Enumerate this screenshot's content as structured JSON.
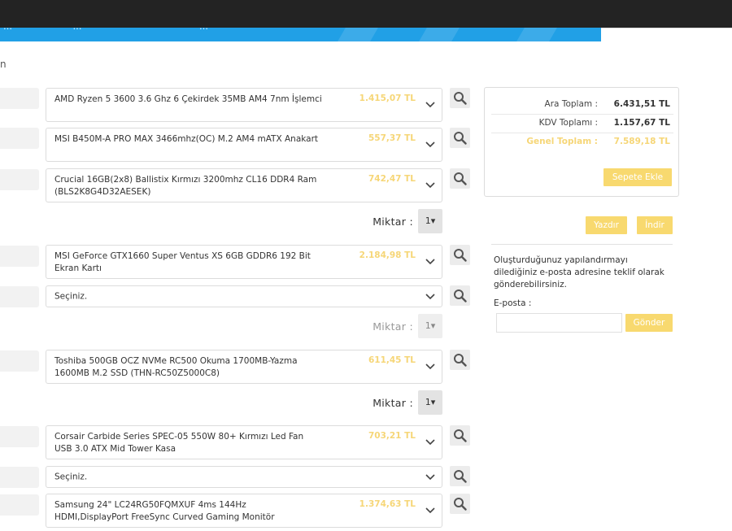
{
  "nav": {
    "items": [
      "…",
      "…",
      "…"
    ]
  },
  "page": {
    "left_glyph": "n"
  },
  "products": [
    {
      "name": "AMD Ryzen 5 3600 3.6 Ghz 6 Çekirdek 35MB AM4 7nm İşlemci",
      "price": "1.415,07 TL"
    },
    {
      "name": "MSI B450M-A PRO MAX 3466mhz(OC) M.2 AM4 mATX Anakart",
      "price": "557,37 TL"
    },
    {
      "name": "Crucial 16GB(2x8) Ballistix Kırmızı 3200mhz CL16 DDR4 Ram (BLS2K8G4D32AESEK)",
      "price": "742,47 TL"
    },
    {
      "name": "MSI GeForce GTX1660 Super Ventus XS 6GB GDDR6 192 Bit Ekran Kartı",
      "price": "2.184,98 TL"
    },
    {
      "name": "Seçiniz.",
      "price": ""
    },
    {
      "name": "Toshiba 500GB OCZ NVMe RC500 Okuma 1700MB-Yazma 1600MB M.2 SSD (THN-RC50Z5000C8)",
      "price": "611,45 TL"
    },
    {
      "name": "Corsair Carbide Series SPEC-05 550W 80+ Kırmızı Led Fan USB 3.0 ATX Mid Tower Kasa",
      "price": "703,21 TL"
    },
    {
      "name": "Seçiniz.",
      "price": ""
    },
    {
      "name": "Samsung 24\" LC24RG50FQMXUF 4ms 144Hz HDMI,DisplayPort FreeSync Curved Gaming Monitör",
      "price": "1.374,63 TL"
    }
  ],
  "quantity": {
    "label": "Miktar :",
    "rows": [
      {
        "value": "1▾",
        "state": "active"
      },
      {
        "value": "1▾",
        "state": "disabled"
      },
      {
        "value": "1▾",
        "state": "active"
      }
    ]
  },
  "summary": {
    "subtotal_label": "Ara Toplam :",
    "subtotal_value": "6.431,51 TL",
    "vat_label": "KDV Toplamı :",
    "vat_value": "1.157,67 TL",
    "total_label": "Genel Toplam :",
    "total_value": "7.589,18 TL",
    "add_to_cart": "Sepete Ekle"
  },
  "actions": {
    "print": "Yazdır",
    "download": "İndir"
  },
  "email": {
    "info": "Oluşturduğunuz yapılandırmayı dilediğiniz e-posta adresine teklif olarak gönderebilirsiniz.",
    "label": "E-posta :",
    "input_value": "",
    "send": "Gönder"
  },
  "colors": {
    "accent_yellow": "#f8d96f",
    "nav_blue": "#21a0e6",
    "topbar": "#232323"
  }
}
